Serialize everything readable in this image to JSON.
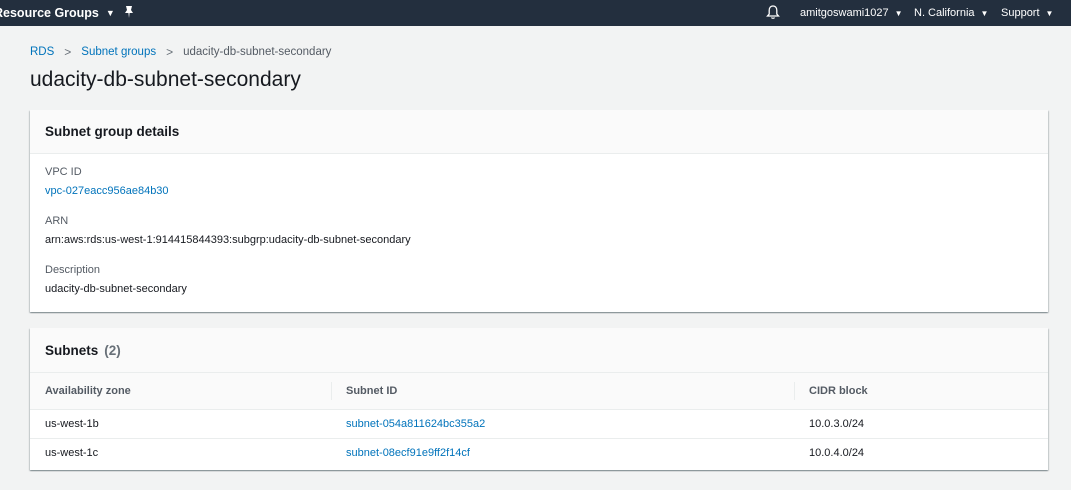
{
  "topnav": {
    "resource_groups": "Resource Groups",
    "user": "amitgoswami1027",
    "region": "N. California",
    "support": "Support"
  },
  "breadcrumb": {
    "items": [
      "RDS",
      "Subnet groups"
    ],
    "current": "udacity-db-subnet-secondary"
  },
  "page_title": "udacity-db-subnet-secondary",
  "details": {
    "title": "Subnet group details",
    "vpc_label": "VPC ID",
    "vpc_value": "vpc-027eacc956ae84b30",
    "arn_label": "ARN",
    "arn_value": "arn:aws:rds:us-west-1:914415844393:subgrp:udacity-db-subnet-secondary",
    "desc_label": "Description",
    "desc_value": "udacity-db-subnet-secondary"
  },
  "subnets": {
    "title": "Subnets",
    "count": "(2)",
    "columns": [
      "Availability zone",
      "Subnet ID",
      "CIDR block"
    ],
    "rows": [
      [
        "us-west-1b",
        "subnet-054a811624bc355a2",
        "10.0.3.0/24"
      ],
      [
        "us-west-1c",
        "subnet-08ecf91e9ff2f14cf",
        "10.0.4.0/24"
      ]
    ]
  }
}
